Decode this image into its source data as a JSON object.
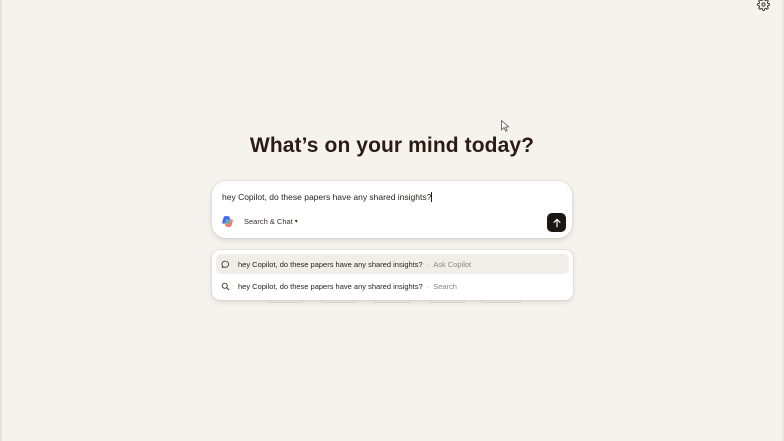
{
  "heading": "What’s on your mind today?",
  "compose": {
    "input_value": "hey Copilot, do these papers have any shared insights?",
    "mode_label": "Search & Chat",
    "mode_chevron": "⌄",
    "logo_icon": "copilot-logo-icon",
    "send_icon": "arrow-up-icon"
  },
  "suggestions": [
    {
      "icon": "chat-bubble-icon",
      "text": "hey Copilot, do these papers have any shared insights?",
      "separator": "·",
      "hint": "Ask Copilot"
    },
    {
      "icon": "search-icon",
      "text": "hey Copilot, do these papers have any shared insights?",
      "separator": "·",
      "hint": "Search"
    }
  ],
  "settings_icon": "gear-icon",
  "colors": {
    "background": "#f6f3ef",
    "heading": "#2b1b14",
    "send_button": "#1c1714",
    "hint_text": "#8d857e",
    "highlight_row": "#f1eeea"
  }
}
